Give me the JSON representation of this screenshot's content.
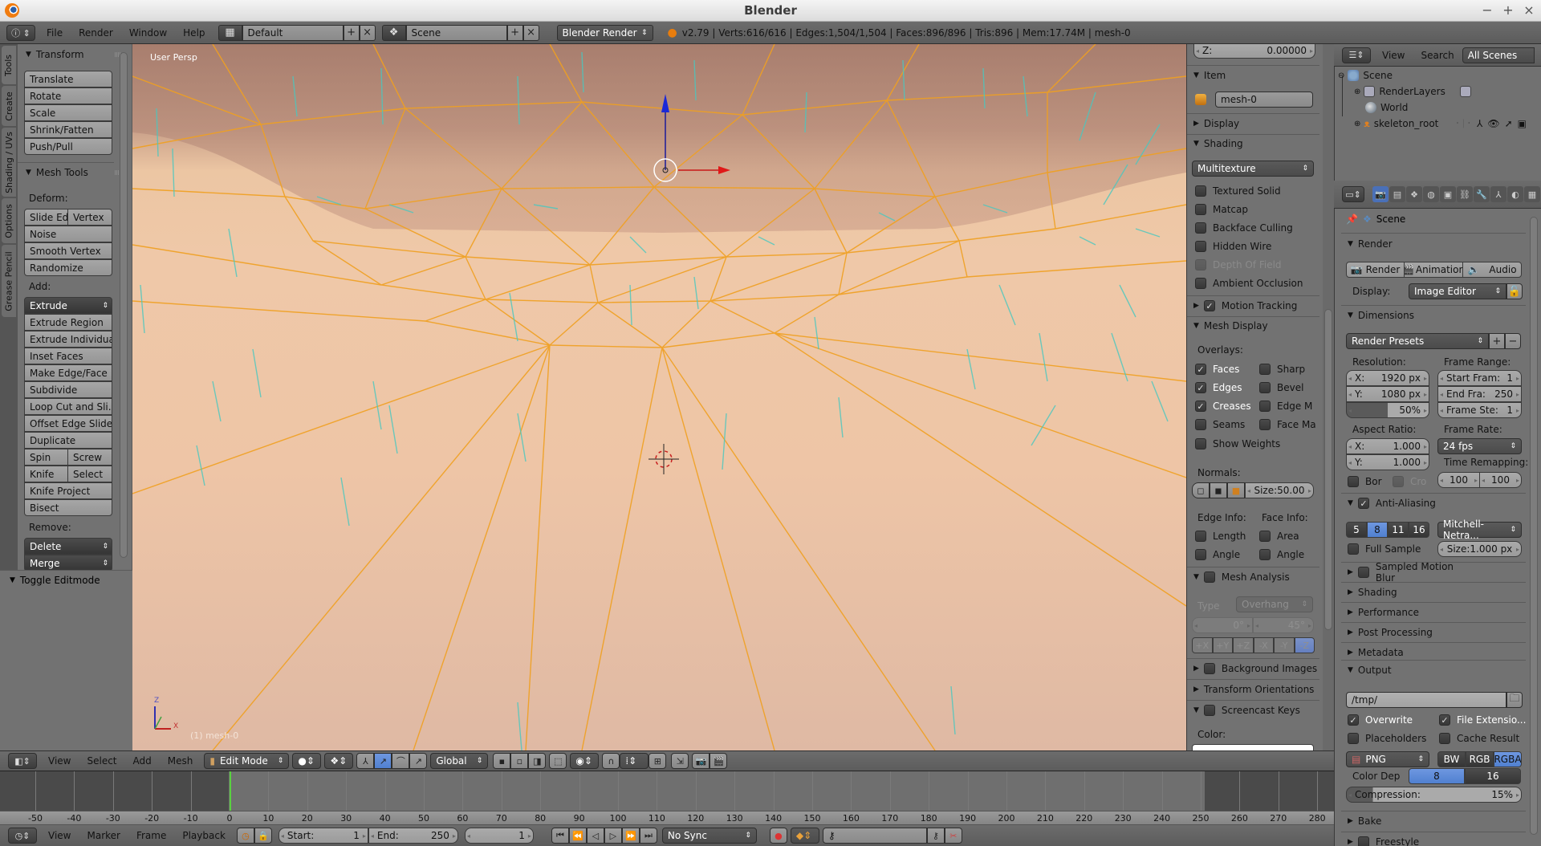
{
  "window": {
    "title": "Blender",
    "controls": {
      "minimize": "−",
      "maximize": "+",
      "close": "×"
    }
  },
  "top_header": {
    "menus": [
      "File",
      "Render",
      "Window",
      "Help"
    ],
    "screen_layout": "Default",
    "scene": "Scene",
    "render_engine": "Blender Render",
    "stats": "v2.79 | Verts:616/616 | Edges:1,504/1,504 | Faces:896/896 | Tris:896 | Mem:17.74M | mesh-0"
  },
  "tool_tabs": [
    "Tools",
    "Create",
    "Shading / UVs",
    "Options",
    "Grease Pencil"
  ],
  "tool_shelf": {
    "transform": {
      "title": "Transform",
      "buttons": [
        "Translate",
        "Rotate",
        "Scale",
        "Shrink/Fatten",
        "Push/Pull"
      ]
    },
    "mesh_tools": {
      "title": "Mesh Tools",
      "deform_label": "Deform:",
      "deform": {
        "slide_edge": "Slide Ed",
        "vertex": "Vertex",
        "noise": "Noise",
        "smooth_vertex": "Smooth Vertex",
        "randomize": "Randomize"
      },
      "add_label": "Add:",
      "extrude_menu": "Extrude",
      "add_buttons": [
        "Extrude Region",
        "Extrude Individual",
        "Inset Faces",
        "Make Edge/Face",
        "Subdivide",
        "Loop Cut and Sli...",
        "Offset Edge Slide",
        "Duplicate"
      ],
      "spin": "Spin",
      "screw": "Screw",
      "knife": "Knife",
      "select": "Select",
      "knife_project": "Knife Project",
      "bisect": "Bisect",
      "remove_label": "Remove:",
      "delete_menu": "Delete",
      "merge_menu": "Merge"
    },
    "toggle_editmode": "Toggle Editmode"
  },
  "viewport": {
    "view_label": "User Persp",
    "object_label": "(1) mesh-0",
    "axis_z": "Z",
    "axis_x": "X"
  },
  "n_panel": {
    "z_field": {
      "label": "Z:",
      "value": "0.00000"
    },
    "item": {
      "title": "Item",
      "name": "mesh-0"
    },
    "display_title": "Display",
    "shading": {
      "title": "Shading",
      "mode": "Multitexture",
      "options": [
        {
          "label": "Textured Solid",
          "checked": false,
          "disabled": false
        },
        {
          "label": "Matcap",
          "checked": false,
          "disabled": false
        },
        {
          "label": "Backface Culling",
          "checked": false,
          "disabled": false
        },
        {
          "label": "Hidden Wire",
          "checked": false,
          "disabled": false
        },
        {
          "label": "Depth Of Field",
          "checked": false,
          "disabled": true
        },
        {
          "label": "Ambient Occlusion",
          "checked": false,
          "disabled": false
        }
      ]
    },
    "motion_tracking": {
      "title": "Motion Tracking",
      "checked": true
    },
    "mesh_display": {
      "title": "Mesh Display",
      "overlays_label": "Overlays:",
      "overlays_left": [
        {
          "label": "Faces",
          "checked": true
        },
        {
          "label": "Edges",
          "checked": true
        },
        {
          "label": "Creases",
          "checked": true
        },
        {
          "label": "Seams",
          "checked": false
        }
      ],
      "overlays_right": [
        {
          "label": "Sharp",
          "checked": false
        },
        {
          "label": "Bevel",
          "checked": false
        },
        {
          "label": "Edge M",
          "checked": false
        },
        {
          "label": "Face Ma",
          "checked": false
        }
      ],
      "show_weights": "Show Weights",
      "normals_label": "Normals:",
      "normals_size": "Size:50.00",
      "edge_info_label": "Edge Info:",
      "face_info_label": "Face Info:",
      "edge_info": [
        "Length",
        "Angle"
      ],
      "face_info": [
        "Area",
        "Angle"
      ]
    },
    "mesh_analysis": {
      "title": "Mesh Analysis",
      "type_label": "Type",
      "type_value": "Overhang",
      "min": "0°",
      "max": "45°",
      "axes": [
        "+X",
        "+Y",
        "+Z",
        "-X",
        "-Y",
        "-Z"
      ],
      "selected_axis": "-Z"
    },
    "background_images": "Background Images",
    "transform_orientations": "Transform Orientations",
    "screencast_keys": "Screencast Keys",
    "color_label": "Color:"
  },
  "outliner": {
    "view": "View",
    "search": "Search",
    "filter": "All Scenes",
    "items": [
      {
        "label": "Scene",
        "level": 0
      },
      {
        "label": "RenderLayers",
        "level": 1
      },
      {
        "label": "World",
        "level": 1
      },
      {
        "label": "skeleton_root",
        "level": 1
      }
    ]
  },
  "properties": {
    "context": "Scene",
    "tabs": [
      "render",
      "render-layers",
      "scene",
      "world",
      "object",
      "constraints",
      "modifiers",
      "data",
      "material",
      "texture"
    ],
    "render": {
      "title": "Render",
      "buttons": [
        "Render",
        "Animation",
        "Audio"
      ],
      "display_label": "Display:",
      "display_value": "Image Editor"
    },
    "dimensions": {
      "title": "Dimensions",
      "presets": "Render Presets",
      "resolution_label": "Resolution:",
      "res_x": {
        "label": "X:",
        "value": "1920 px"
      },
      "res_y": {
        "label": "Y:",
        "value": "1080 px"
      },
      "res_percent": "50%",
      "res_percent_value": 50,
      "frame_range_label": "Frame Range:",
      "start": {
        "label": "Start Fram:",
        "value": "1"
      },
      "end": {
        "label": "End Fra:",
        "value": "250"
      },
      "step": {
        "label": "Frame Ste:",
        "value": "1"
      },
      "aspect_label": "Aspect Ratio:",
      "aspect_x": {
        "label": "X:",
        "value": "1.000"
      },
      "aspect_y": {
        "label": "Y:",
        "value": "1.000"
      },
      "frame_rate_label": "Frame Rate:",
      "frame_rate": "24 fps",
      "time_remap_label": "Time Remapping:",
      "remap_old": "100",
      "remap_new": "100",
      "border": "Bor",
      "crop": "Cro"
    },
    "anti_aliasing": {
      "title": "Anti-Aliasing",
      "checked": true,
      "samples": [
        "5",
        "8",
        "11",
        "16"
      ],
      "selected": "8",
      "filter": "Mitchell-Netra...",
      "full_sample": "Full Sample",
      "size": "Size:1.000 px"
    },
    "collapsed_panels": [
      "Sampled Motion Blur",
      "Shading",
      "Performance",
      "Post Processing",
      "Metadata"
    ],
    "output": {
      "title": "Output",
      "path": "/tmp/",
      "overwrite": {
        "label": "Overwrite",
        "checked": true
      },
      "file_ext": {
        "label": "File Extensio...",
        "checked": true
      },
      "placeholders": {
        "label": "Placeholders",
        "checked": false
      },
      "cache_result": {
        "label": "Cache Result",
        "checked": false
      },
      "format": "PNG",
      "color_modes": [
        "BW",
        "RGB",
        "RGBA"
      ],
      "selected_color": "RGBA",
      "color_depth_label": "Color Dep",
      "depths": [
        "8",
        "16"
      ],
      "selected_depth": "8",
      "compression": "Compression:",
      "compression_value": "15%",
      "compression_percent": 15
    },
    "bake": "Bake",
    "freestyle": "Freestyle"
  },
  "view3d_header": {
    "menus": [
      "View",
      "Select",
      "Add",
      "Mesh"
    ],
    "mode": "Edit Mode",
    "orientation": "Global"
  },
  "timeline": {
    "ticks": [
      "-50",
      "-40",
      "-30",
      "-20",
      "-10",
      "0",
      "10",
      "20",
      "30",
      "40",
      "50",
      "60",
      "70",
      "80",
      "90",
      "100",
      "110",
      "120",
      "130",
      "140",
      "150",
      "160",
      "170",
      "180",
      "190",
      "200",
      "210",
      "220",
      "230",
      "240",
      "250",
      "260",
      "270",
      "280"
    ],
    "current_frame": 1,
    "menus": [
      "View",
      "Marker",
      "Frame",
      "Playback"
    ],
    "start": {
      "label": "Start:",
      "value": "1"
    },
    "end": {
      "label": "End:",
      "value": "250"
    },
    "frame": "1",
    "sync": "No Sync"
  }
}
